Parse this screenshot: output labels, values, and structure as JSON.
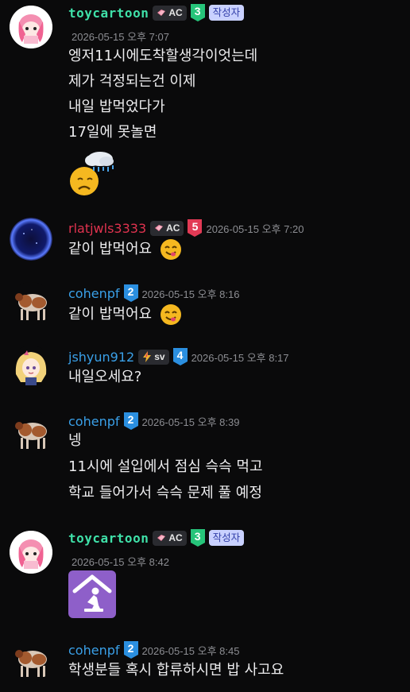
{
  "messages": [
    {
      "author": "toycartoon",
      "badge_ac": "AC",
      "level": "3",
      "author_label": "작성자",
      "timestamp": "2026-05-15 오후 7:07",
      "lines": [
        "엥저11시에도착할생각이엇는데",
        "제가 걱정되는건 이제",
        "내일 밥먹었다가",
        "17일에 못놀면"
      ],
      "emoji": "sweating-rain-cloud-face"
    },
    {
      "author": "rlatjwls3333",
      "badge_ac": "AC",
      "level": "5",
      "timestamp": "2026-05-15 오후 7:20",
      "lines": [
        "같이 밥먹어요"
      ],
      "emoji": "yum-face"
    },
    {
      "author": "cohenpf",
      "level": "2",
      "timestamp": "2026-05-15 오후 8:16",
      "lines": [
        "같이 밥먹어요"
      ],
      "emoji": "yum-face"
    },
    {
      "author": "jshyun912",
      "badge_sv": "sv",
      "level": "4",
      "timestamp": "2026-05-15 오후 8:17",
      "lines": [
        "내일오세요?"
      ]
    },
    {
      "author": "cohenpf",
      "level": "2",
      "timestamp": "2026-05-15 오후 8:39",
      "lines": [
        "넹",
        "11시에 설입에서 점심 슥슥 먹고",
        "학교 들어가서 슥슥 문제 풀 예정"
      ]
    },
    {
      "author": "toycartoon",
      "badge_ac": "AC",
      "level": "3",
      "author_label": "작성자",
      "timestamp": "2026-05-15 오후 8:42",
      "emoji": "shelter-kneeling-sticker"
    },
    {
      "author": "cohenpf",
      "level": "2",
      "timestamp": "2026-05-15 오후 8:45",
      "lines": [
        "학생분들 혹시 합류하시면 밥 사고요"
      ]
    }
  ],
  "colors": {
    "toycartoon": "#3fe0a8",
    "rlatjwls3333": "#e0334f",
    "cohenpf": "#3aa0e8",
    "jshyun912": "#3aa0e8",
    "level2": "#2b8fe0",
    "level3": "#26c47a",
    "level4": "#2b8fe0",
    "level5": "#e23a55"
  }
}
